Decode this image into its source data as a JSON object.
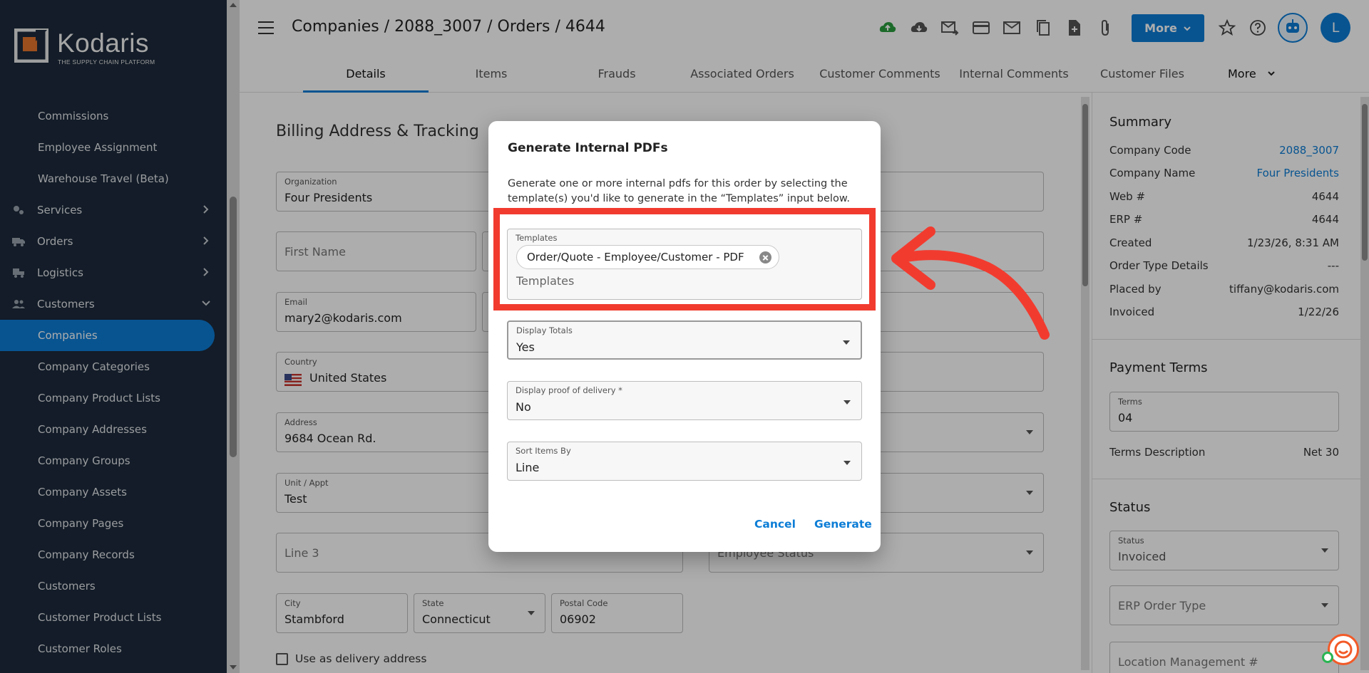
{
  "brand": {
    "name": "Kodaris",
    "tagline": "THE SUPPLY CHAIN PLATFORM"
  },
  "sidebar": {
    "items": [
      {
        "label": "Commissions",
        "type": "sub"
      },
      {
        "label": "Employee Assignment",
        "type": "sub"
      },
      {
        "label": "Warehouse Travel (Beta)",
        "type": "sub"
      },
      {
        "label": "Services",
        "type": "top",
        "icon": "services-icon"
      },
      {
        "label": "Orders",
        "type": "top",
        "icon": "truck-icon"
      },
      {
        "label": "Logistics",
        "type": "top",
        "icon": "logistics-icon"
      },
      {
        "label": "Customers",
        "type": "top",
        "icon": "customers-icon"
      },
      {
        "label": "Companies",
        "type": "sub",
        "active": true
      },
      {
        "label": "Company Categories",
        "type": "sub"
      },
      {
        "label": "Company Product Lists",
        "type": "sub"
      },
      {
        "label": "Company Addresses",
        "type": "sub"
      },
      {
        "label": "Company Groups",
        "type": "sub"
      },
      {
        "label": "Company Assets",
        "type": "sub"
      },
      {
        "label": "Company Pages",
        "type": "sub"
      },
      {
        "label": "Company Records",
        "type": "sub"
      },
      {
        "label": "Customers",
        "type": "sub"
      },
      {
        "label": "Customer Product Lists",
        "type": "sub"
      },
      {
        "label": "Customer Roles",
        "type": "sub"
      }
    ]
  },
  "header": {
    "breadcrumb": "Companies / 2088_3007 / Orders / 4644",
    "more_label": "More",
    "avatar_initial": "L"
  },
  "tabs": [
    "Details",
    "Items",
    "Frauds",
    "Associated Orders",
    "Customer Comments",
    "Internal Comments",
    "Customer Files",
    "More"
  ],
  "billing": {
    "title": "Billing Address & Tracking",
    "organization": {
      "label": "Organization",
      "value": "Four Presidents"
    },
    "first_name": {
      "placeholder": "First Name"
    },
    "email": {
      "label": "Email",
      "value": "mary2@kodaris.com"
    },
    "country": {
      "label": "Country",
      "value": "United States"
    },
    "address": {
      "label": "Address",
      "value": "9684 Ocean Rd."
    },
    "unit": {
      "label": "Unit / Appt",
      "value": "Test"
    },
    "line3": {
      "placeholder": "Line 3"
    },
    "employee_status": {
      "placeholder": "Employee Status"
    },
    "city": {
      "label": "City",
      "value": "Stambford"
    },
    "state": {
      "label": "State",
      "value": "Connecticut"
    },
    "postal": {
      "label": "Postal Code",
      "value": "06902"
    },
    "delivery_checkbox": "Use as delivery address"
  },
  "summary": {
    "title": "Summary",
    "rows": [
      {
        "key": "Company Code",
        "value": "2088_3007",
        "link": true
      },
      {
        "key": "Company Name",
        "value": "Four Presidents",
        "link": true
      },
      {
        "key": "Web #",
        "value": "4644"
      },
      {
        "key": "ERP #",
        "value": "4644"
      },
      {
        "key": "Created",
        "value": "1/23/26, 8:31 AM"
      },
      {
        "key": "Order Type Details",
        "value": "---"
      },
      {
        "key": "Placed by",
        "value": "tiffany@kodaris.com"
      },
      {
        "key": "Invoiced",
        "value": "1/22/26"
      }
    ]
  },
  "payment_terms": {
    "title": "Payment Terms",
    "terms_label": "Terms",
    "terms_value": "04",
    "desc_key": "Terms Description",
    "desc_value": "Net 30"
  },
  "status": {
    "title": "Status",
    "status_label": "Status",
    "status_value": "Invoiced",
    "erp_order_type": "ERP Order Type",
    "location_mgmt": "Location Management #"
  },
  "modal": {
    "title": "Generate Internal PDFs",
    "description": "Generate one or more internal pdfs for this order by selecting the template(s) you'd like to generate in the “Templates” input below.",
    "templates_label": "Templates",
    "template_chip": "Order/Quote - Employee/Customer - PDF",
    "templates_placeholder": "Templates",
    "display_totals_label": "Display Totals",
    "display_totals_value": "Yes",
    "proof_label": "Display proof of delivery *",
    "proof_value": "No",
    "sort_label": "Sort Items By",
    "sort_value": "Line",
    "cancel": "Cancel",
    "generate": "Generate"
  },
  "colors": {
    "accent": "#0c7dd6",
    "sidebar": "#1c2a3b",
    "annotation": "#f23b2f"
  }
}
